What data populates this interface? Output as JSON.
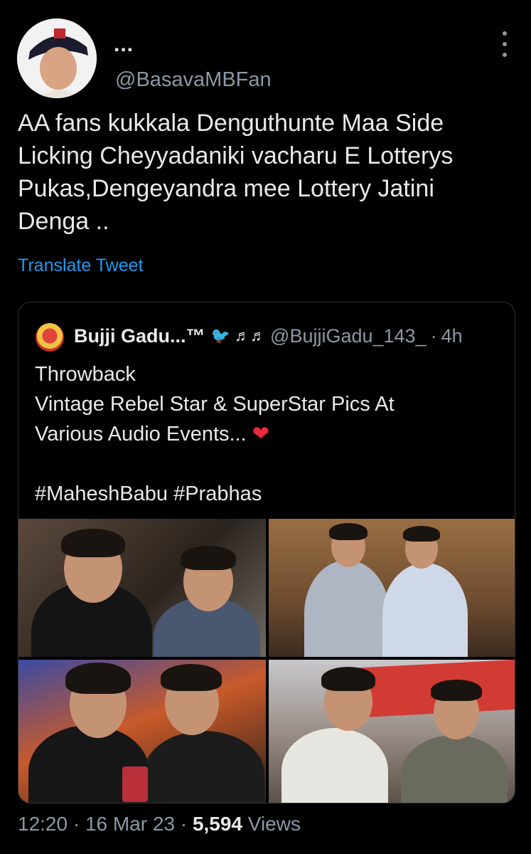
{
  "author": {
    "display_name": "...",
    "handle": "@BasavaMBFan"
  },
  "tweet": {
    "text": "AA fans kukkala Denguthunte Maa Side\nLicking Cheyyadaniki vacharu E Lotterys\nPukas,Dengeyandra mee Lottery Jatini\nDenga ..",
    "translate_label": "Translate Tweet"
  },
  "quoted": {
    "display_name": "Bujji Gadu...™",
    "icons": "🐦 ♬♬",
    "handle": "@BujjiGadu_143_",
    "separator": "·",
    "time": "4h",
    "text": "Throwback\nVintage Rebel Star & SuperStar Pics At\nVarious Audio Events... ",
    "heart": "❤",
    "hashtags": "#MaheshBabu #Prabhas"
  },
  "footer": {
    "time": "12:20",
    "sep1": " · ",
    "date": "16 Mar 23",
    "sep2": " · ",
    "views_count": "5,594",
    "views_label": " Views"
  },
  "colors": {
    "background": "#000000",
    "text": "#e7e9ea",
    "muted": "#8b98a5",
    "link": "#1d9bf0",
    "heart": "#ee2a3a"
  }
}
